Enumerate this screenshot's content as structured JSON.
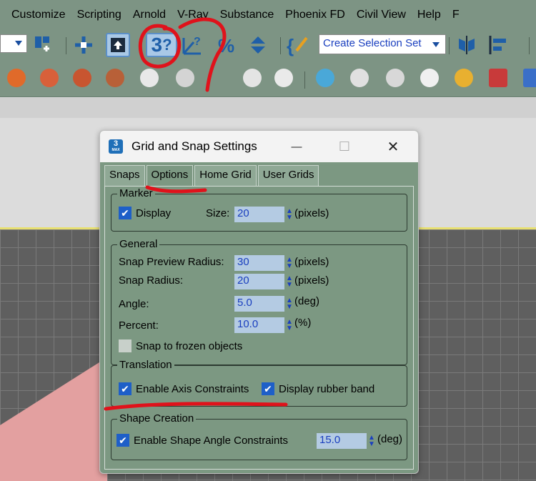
{
  "menu": [
    "Customize",
    "Scripting",
    "Arnold",
    "V-Ray",
    "Substance",
    "Phoenix FD",
    "Civil View",
    "Help",
    "F"
  ],
  "toolbar": {
    "angle_snap_text": "3",
    "selection_set": "Create Selection Set"
  },
  "dialog": {
    "title": "Grid and Snap Settings",
    "app_badge": "3",
    "app_badge_sub": "MAX",
    "minimize": "—",
    "maximize": "☐",
    "close": "✕",
    "tabs": [
      "Snaps",
      "Options",
      "Home Grid",
      "User Grids"
    ],
    "selected_tab": "Options",
    "marker": {
      "title": "Marker",
      "display_label": "Display",
      "display_checked": true,
      "size_label": "Size:",
      "size_value": "20",
      "size_unit": "(pixels)"
    },
    "general": {
      "title": "General",
      "snap_preview_radius_label": "Snap Preview Radius:",
      "snap_preview_radius_value": "30",
      "snap_preview_radius_unit": "(pixels)",
      "snap_radius_label": "Snap Radius:",
      "snap_radius_value": "20",
      "snap_radius_unit": "(pixels)",
      "angle_label": "Angle:",
      "angle_value": "5.0",
      "angle_unit": "(deg)",
      "percent_label": "Percent:",
      "percent_value": "10.0",
      "percent_unit": "(%)",
      "snap_frozen_label": "Snap to frozen objects",
      "snap_frozen_checked": false
    },
    "translation": {
      "title": "Translation",
      "axis_constraints_label": "Enable Axis Constraints",
      "axis_constraints_checked": true,
      "rubber_band_label": "Display rubber band",
      "rubber_band_checked": true
    },
    "shape_creation": {
      "title": "Shape Creation",
      "angle_constraints_label": "Enable Shape Angle Constraints",
      "angle_constraints_checked": true,
      "angle_value": "15.0",
      "angle_unit": "(deg)"
    }
  },
  "colors": {
    "menubar": "#7d9484",
    "dialog_bg": "#7c9882",
    "spinner_bg": "#b4cbe3",
    "checkbox_on": "#1e5fc8",
    "annotation": "#e0121b"
  }
}
